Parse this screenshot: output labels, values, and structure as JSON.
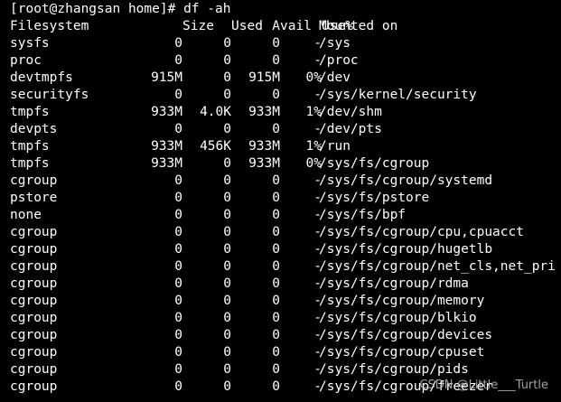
{
  "terminal": {
    "prompt": "[root@zhangsan home]# ",
    "command": "df -ah",
    "header": {
      "filesystem": "Filesystem",
      "size": "Size",
      "used": "Used",
      "avail": "Avail",
      "use_pct": "Use%",
      "mounted_on": "Mounted on"
    },
    "rows": [
      {
        "fs": "sysfs",
        "size": "0",
        "used": "0",
        "avail": "0",
        "pct": "-",
        "mount": "/sys"
      },
      {
        "fs": "proc",
        "size": "0",
        "used": "0",
        "avail": "0",
        "pct": "-",
        "mount": "/proc"
      },
      {
        "fs": "devtmpfs",
        "size": "915M",
        "used": "0",
        "avail": "915M",
        "pct": "0%",
        "mount": "/dev"
      },
      {
        "fs": "securityfs",
        "size": "0",
        "used": "0",
        "avail": "0",
        "pct": "-",
        "mount": "/sys/kernel/security"
      },
      {
        "fs": "tmpfs",
        "size": "933M",
        "used": "4.0K",
        "avail": "933M",
        "pct": "1%",
        "mount": "/dev/shm"
      },
      {
        "fs": "devpts",
        "size": "0",
        "used": "0",
        "avail": "0",
        "pct": "-",
        "mount": "/dev/pts"
      },
      {
        "fs": "tmpfs",
        "size": "933M",
        "used": "456K",
        "avail": "933M",
        "pct": "1%",
        "mount": "/run"
      },
      {
        "fs": "tmpfs",
        "size": "933M",
        "used": "0",
        "avail": "933M",
        "pct": "0%",
        "mount": "/sys/fs/cgroup"
      },
      {
        "fs": "cgroup",
        "size": "0",
        "used": "0",
        "avail": "0",
        "pct": "-",
        "mount": "/sys/fs/cgroup/systemd"
      },
      {
        "fs": "pstore",
        "size": "0",
        "used": "0",
        "avail": "0",
        "pct": "-",
        "mount": "/sys/fs/pstore"
      },
      {
        "fs": "none",
        "size": "0",
        "used": "0",
        "avail": "0",
        "pct": "-",
        "mount": "/sys/fs/bpf"
      },
      {
        "fs": "cgroup",
        "size": "0",
        "used": "0",
        "avail": "0",
        "pct": "-",
        "mount": "/sys/fs/cgroup/cpu,cpuacct"
      },
      {
        "fs": "cgroup",
        "size": "0",
        "used": "0",
        "avail": "0",
        "pct": "-",
        "mount": "/sys/fs/cgroup/hugetlb"
      },
      {
        "fs": "cgroup",
        "size": "0",
        "used": "0",
        "avail": "0",
        "pct": "-",
        "mount": "/sys/fs/cgroup/net_cls,net_pri"
      },
      {
        "fs": "cgroup",
        "size": "0",
        "used": "0",
        "avail": "0",
        "pct": "-",
        "mount": "/sys/fs/cgroup/rdma"
      },
      {
        "fs": "cgroup",
        "size": "0",
        "used": "0",
        "avail": "0",
        "pct": "-",
        "mount": "/sys/fs/cgroup/memory"
      },
      {
        "fs": "cgroup",
        "size": "0",
        "used": "0",
        "avail": "0",
        "pct": "-",
        "mount": "/sys/fs/cgroup/blkio"
      },
      {
        "fs": "cgroup",
        "size": "0",
        "used": "0",
        "avail": "0",
        "pct": "-",
        "mount": "/sys/fs/cgroup/devices"
      },
      {
        "fs": "cgroup",
        "size": "0",
        "used": "0",
        "avail": "0",
        "pct": "-",
        "mount": "/sys/fs/cgroup/cpuset"
      },
      {
        "fs": "cgroup",
        "size": "0",
        "used": "0",
        "avail": "0",
        "pct": "-",
        "mount": "/sys/fs/cgroup/pids"
      },
      {
        "fs": "cgroup",
        "size": "0",
        "used": "0",
        "avail": "0",
        "pct": "-",
        "mount": "/sys/fs/cgroup/freezer"
      }
    ],
    "watermark": "CSDN @Little___Turtle",
    "colors": {
      "background": "#000000",
      "foreground": "#ffffff",
      "watermark": "#bdbdbd"
    }
  }
}
